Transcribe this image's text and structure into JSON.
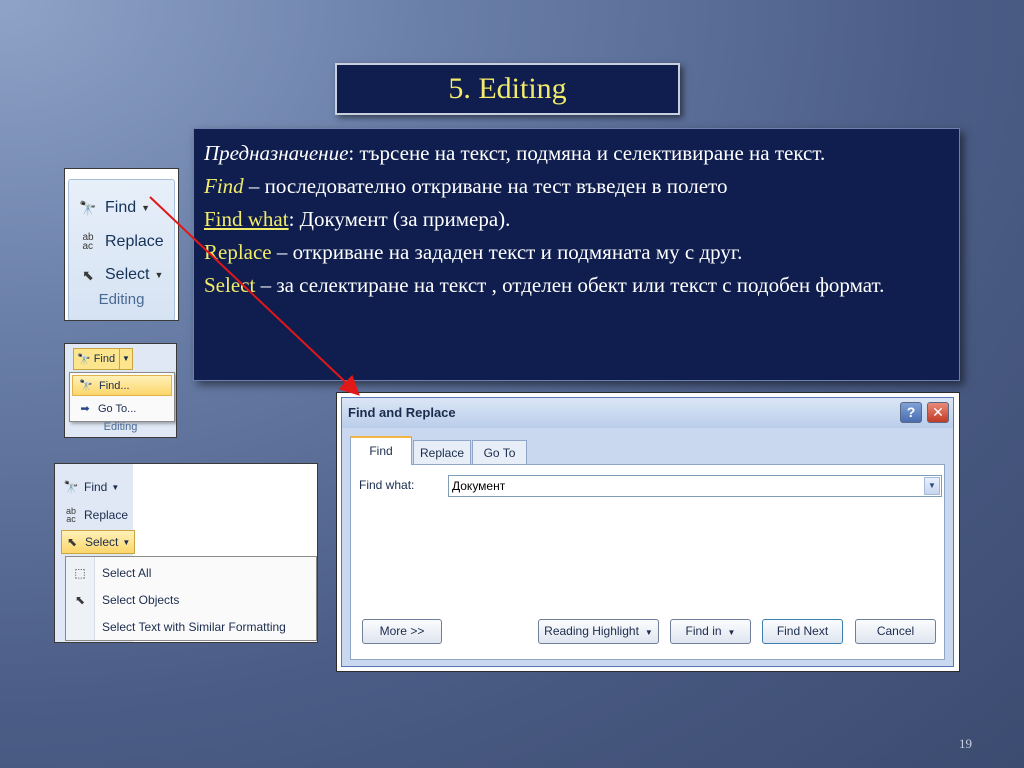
{
  "slide": {
    "title": "5. Editing",
    "page_number": "19"
  },
  "description": {
    "line1_term": "Предназначение",
    "line1_text": ": търсене на текст, подмяна и селективиране на текст.",
    "find_term": "Find",
    "find_text": " – последователно откриване на тест въведен в полето",
    "find_what_term": "Find what",
    "find_what_text": ": Документ (за примера).",
    "replace_term": "Replace",
    "replace_text": " – откриване на зададен текст и подмяната му с друг.",
    "select_term": "Select",
    "select_text": " – за селектиране на текст , отделен обект или текст с подобен формат."
  },
  "ribbon_editing": {
    "find_label": "Find",
    "replace_label": "Replace",
    "select_label": "Select",
    "group_label": "Editing"
  },
  "ribbon_find_menu": {
    "find_label": "Find",
    "items": [
      "Find...",
      "Go To..."
    ],
    "group_label": "Editing"
  },
  "ribbon_select_menu": {
    "find_label": "Find",
    "replace_label": "Replace",
    "select_label": "Select",
    "items": [
      "Select All",
      "Select Objects",
      "Select Text with Similar Formatting"
    ]
  },
  "dialog": {
    "title": "Find and Replace",
    "help_label": "?",
    "close_label": "✕",
    "tabs": [
      "Find",
      "Replace",
      "Go To"
    ],
    "find_what_label": "Find what:",
    "find_what_value": "Документ",
    "buttons": {
      "more": "More >>",
      "reading_highlight": "Reading Highlight",
      "find_in": "Find in",
      "find_next": "Find Next",
      "cancel": "Cancel"
    }
  },
  "colors": {
    "accent_yellow": "#f3ec6a",
    "box_navy": "#0f1e4f",
    "arrow_red": "#e01818"
  }
}
